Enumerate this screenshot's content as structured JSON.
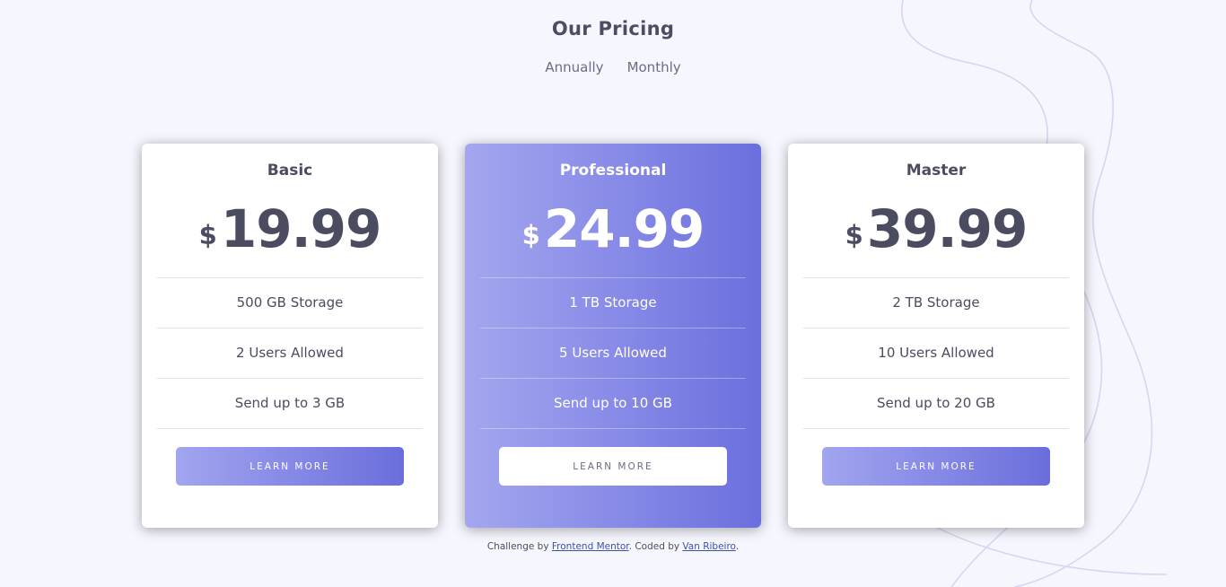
{
  "header": {
    "title": "Our Pricing",
    "toggle": {
      "annually_label": "Annually",
      "monthly_label": "Monthly"
    }
  },
  "plans": [
    {
      "name": "Basic",
      "currency": "$",
      "price": "19.99",
      "features": [
        "500 GB Storage",
        "2 Users Allowed",
        "Send up to 3 GB"
      ],
      "button_label": "LEARN MORE"
    },
    {
      "name": "Professional",
      "currency": "$",
      "price": "24.99",
      "features": [
        "1 TB Storage",
        "5 Users Allowed",
        "Send up to 10 GB"
      ],
      "button_label": "LEARN MORE"
    },
    {
      "name": "Master",
      "currency": "$",
      "price": "39.99",
      "features": [
        "2 TB Storage",
        "10 Users Allowed",
        "Send up to 20 GB"
      ],
      "button_label": "LEARN MORE"
    }
  ],
  "footer": {
    "prefix": "Challenge by ",
    "link1": "Frontend Mentor",
    "middle": ". Coded by ",
    "link2": "Van Ribeiro",
    "suffix": "."
  },
  "colors": {
    "background": "#f6f6fe",
    "accent_start": "#a2a5ef",
    "accent_end": "#6a6edc",
    "text": "#4b4d62"
  }
}
